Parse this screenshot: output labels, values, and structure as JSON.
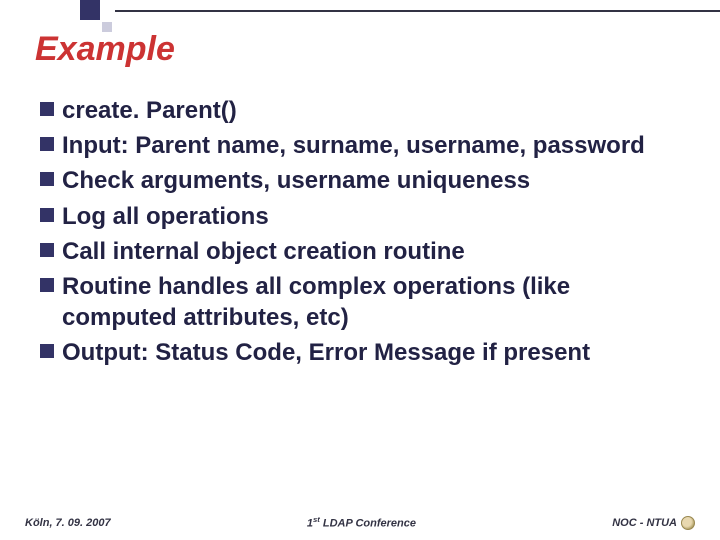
{
  "title": "Example",
  "bullets": [
    "create. Parent()",
    "Input: Parent name, surname, username, password",
    "Check arguments, username uniqueness",
    "Log all operations",
    "Call internal object creation routine",
    "Routine handles all complex operations (like computed attributes, etc)",
    "Output: Status Code, Error Message if present"
  ],
  "footer": {
    "left": "Köln, 7. 09. 2007",
    "center_prefix": "1",
    "center_sup": "st",
    "center_suffix": " LDAP Conference",
    "right": "NOC - NTUA"
  }
}
